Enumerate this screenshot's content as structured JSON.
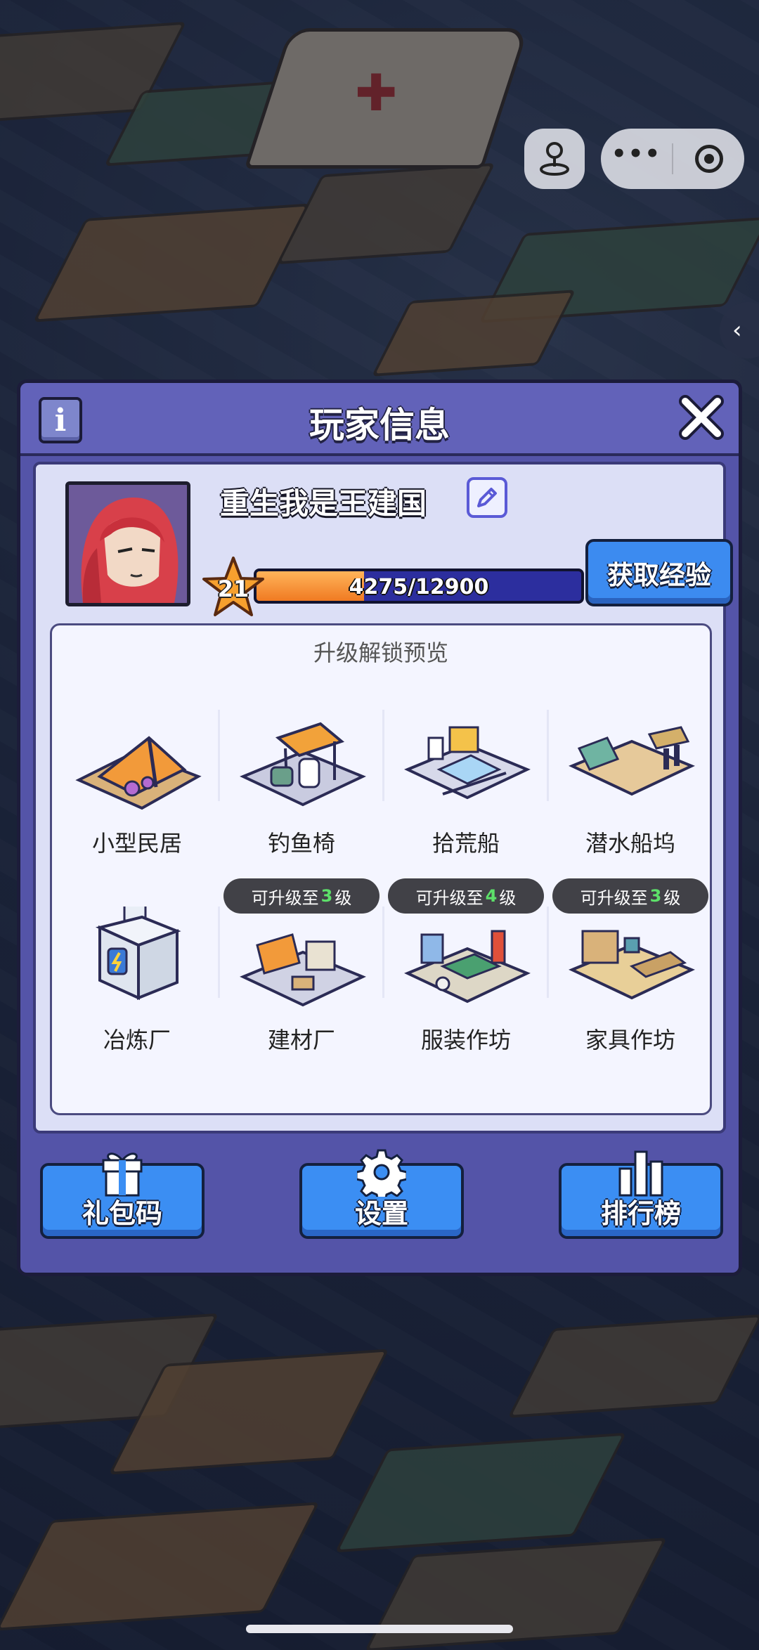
{
  "top_controls": {
    "joystick_icon": "joystick-icon",
    "more_icon": "more-dots-icon",
    "more_glyph": "•••",
    "close_miniprogram_icon": "target-circle-icon",
    "side_toggle_icon": "chevron-left-icon",
    "side_toggle_glyph": "‹"
  },
  "panel": {
    "title": "玩家信息",
    "info_glyph": "i",
    "close_icon": "close-x-icon"
  },
  "player": {
    "name": "重生我是王建国",
    "level": "21",
    "xp_text": "4275/12900",
    "xp_current": 4275,
    "xp_max": 12900,
    "get_xp_label": "获取经验"
  },
  "unlock_preview": {
    "title": "升级解锁预览",
    "items": [
      {
        "name": "小型民居",
        "badge": null
      },
      {
        "name": "钓鱼椅",
        "badge": null
      },
      {
        "name": "拾荒船",
        "badge": null
      },
      {
        "name": "潜水船坞",
        "badge": null
      },
      {
        "name": "冶炼厂",
        "badge": null
      },
      {
        "name": "建材厂",
        "badge_prefix": "可升级至",
        "badge_level": "3",
        "badge_suffix": "级"
      },
      {
        "name": "服装作坊",
        "badge_prefix": "可升级至",
        "badge_level": "4",
        "badge_suffix": "级"
      },
      {
        "name": "家具作坊",
        "badge_prefix": "可升级至",
        "badge_level": "3",
        "badge_suffix": "级"
      }
    ]
  },
  "bottom_buttons": {
    "gift_code": {
      "label": "礼包码",
      "icon": "gift-icon"
    },
    "settings": {
      "label": "设置",
      "icon": "gear-icon"
    },
    "leaderboard": {
      "label": "排行榜",
      "icon": "bar-chart-icon"
    }
  },
  "colors": {
    "panel_bg": "#5454a8",
    "button_blue": "#3b8ef3",
    "xp_fill": "#f07a22",
    "badge_level": "#5de06a"
  }
}
